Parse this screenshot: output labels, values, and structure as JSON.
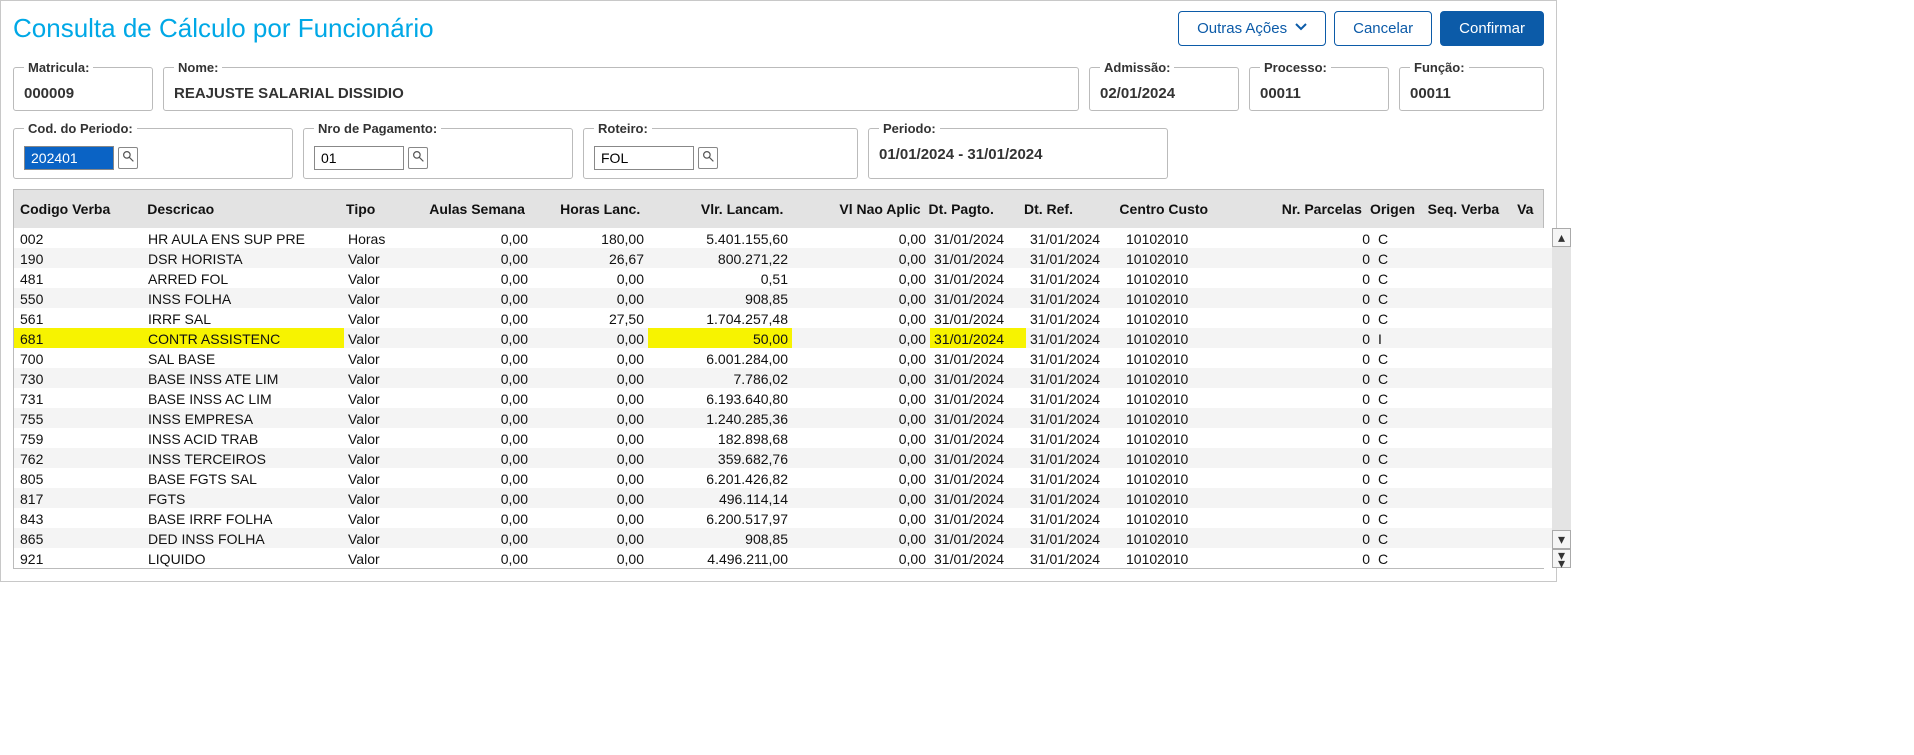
{
  "title": "Consulta de Cálculo por Funcionário",
  "buttons": {
    "outras": "Outras Ações",
    "cancel": "Cancelar",
    "confirm": "Confirmar"
  },
  "labels": {
    "matricula": "Matricula:",
    "nome": "Nome:",
    "admissao": "Admissão:",
    "processo": "Processo:",
    "funcao": "Função:",
    "cod_periodo": "Cod. do Periodo:",
    "nro_pagamento": "Nro de Pagamento:",
    "roteiro": "Roteiro:",
    "periodo": "Periodo:"
  },
  "fields": {
    "matricula": "000009",
    "nome": "REAJUSTE SALARIAL DISSIDIO",
    "admissao": "02/01/2024",
    "processo": "00011",
    "funcao": "00011",
    "cod_periodo": "202401",
    "nro_pagamento": "01",
    "roteiro": "FOL",
    "periodo": "01/01/2024 - 31/01/2024"
  },
  "columns": {
    "cod": "Codigo Verba",
    "desc": "Descricao",
    "tipo": "Tipo",
    "aul": "Aulas Semana",
    "hrs": "Horas Lanc.",
    "vlr": "Vlr. Lancam.",
    "vna": "Vl Nao Aplic",
    "dtp": "Dt. Pagto.",
    "dtr": "Dt. Ref.",
    "cc": "Centro Custo",
    "np": "Nr. Parcelas",
    "ori": "Origen",
    "seq": "Seq. Verba",
    "last": "Va"
  },
  "rows": [
    {
      "cod": "002",
      "desc": "HR AULA ENS SUP PRE",
      "tipo": "Horas",
      "aul": "0,00",
      "hrs": "180,00",
      "vlr": "5.401.155,60",
      "vna": "0,00",
      "dtp": "31/01/2024",
      "dtr": "31/01/2024",
      "cc": "10102010",
      "np": "0",
      "ori": "C",
      "seq": ""
    },
    {
      "cod": "190",
      "desc": "DSR HORISTA",
      "tipo": "Valor",
      "aul": "0,00",
      "hrs": "26,67",
      "vlr": "800.271,22",
      "vna": "0,00",
      "dtp": "31/01/2024",
      "dtr": "31/01/2024",
      "cc": "10102010",
      "np": "0",
      "ori": "C",
      "seq": ""
    },
    {
      "cod": "481",
      "desc": "ARRED FOL",
      "tipo": "Valor",
      "aul": "0,00",
      "hrs": "0,00",
      "vlr": "0,51",
      "vna": "0,00",
      "dtp": "31/01/2024",
      "dtr": "31/01/2024",
      "cc": "10102010",
      "np": "0",
      "ori": "C",
      "seq": ""
    },
    {
      "cod": "550",
      "desc": "INSS FOLHA",
      "tipo": "Valor",
      "aul": "0,00",
      "hrs": "0,00",
      "vlr": "908,85",
      "vna": "0,00",
      "dtp": "31/01/2024",
      "dtr": "31/01/2024",
      "cc": "10102010",
      "np": "0",
      "ori": "C",
      "seq": ""
    },
    {
      "cod": "561",
      "desc": "IRRF SAL",
      "tipo": "Valor",
      "aul": "0,00",
      "hrs": "27,50",
      "vlr": "1.704.257,48",
      "vna": "0,00",
      "dtp": "31/01/2024",
      "dtr": "31/01/2024",
      "cc": "10102010",
      "np": "0",
      "ori": "C",
      "seq": ""
    },
    {
      "cod": "681",
      "desc": "CONTR ASSISTENC",
      "tipo": "Valor",
      "aul": "0,00",
      "hrs": "0,00",
      "vlr": "50,00",
      "vna": "0,00",
      "dtp": "31/01/2024",
      "dtr": "31/01/2024",
      "cc": "10102010",
      "np": "0",
      "ori": "I",
      "seq": "",
      "hl": true
    },
    {
      "cod": "700",
      "desc": "SAL BASE",
      "tipo": "Valor",
      "aul": "0,00",
      "hrs": "0,00",
      "vlr": "6.001.284,00",
      "vna": "0,00",
      "dtp": "31/01/2024",
      "dtr": "31/01/2024",
      "cc": "10102010",
      "np": "0",
      "ori": "C",
      "seq": ""
    },
    {
      "cod": "730",
      "desc": "BASE INSS ATE LIM",
      "tipo": "Valor",
      "aul": "0,00",
      "hrs": "0,00",
      "vlr": "7.786,02",
      "vna": "0,00",
      "dtp": "31/01/2024",
      "dtr": "31/01/2024",
      "cc": "10102010",
      "np": "0",
      "ori": "C",
      "seq": ""
    },
    {
      "cod": "731",
      "desc": "BASE INSS AC LIM",
      "tipo": "Valor",
      "aul": "0,00",
      "hrs": "0,00",
      "vlr": "6.193.640,80",
      "vna": "0,00",
      "dtp": "31/01/2024",
      "dtr": "31/01/2024",
      "cc": "10102010",
      "np": "0",
      "ori": "C",
      "seq": ""
    },
    {
      "cod": "755",
      "desc": "INSS EMPRESA",
      "tipo": "Valor",
      "aul": "0,00",
      "hrs": "0,00",
      "vlr": "1.240.285,36",
      "vna": "0,00",
      "dtp": "31/01/2024",
      "dtr": "31/01/2024",
      "cc": "10102010",
      "np": "0",
      "ori": "C",
      "seq": ""
    },
    {
      "cod": "759",
      "desc": "INSS ACID TRAB",
      "tipo": "Valor",
      "aul": "0,00",
      "hrs": "0,00",
      "vlr": "182.898,68",
      "vna": "0,00",
      "dtp": "31/01/2024",
      "dtr": "31/01/2024",
      "cc": "10102010",
      "np": "0",
      "ori": "C",
      "seq": ""
    },
    {
      "cod": "762",
      "desc": "INSS TERCEIROS",
      "tipo": "Valor",
      "aul": "0,00",
      "hrs": "0,00",
      "vlr": "359.682,76",
      "vna": "0,00",
      "dtp": "31/01/2024",
      "dtr": "31/01/2024",
      "cc": "10102010",
      "np": "0",
      "ori": "C",
      "seq": ""
    },
    {
      "cod": "805",
      "desc": "BASE FGTS SAL",
      "tipo": "Valor",
      "aul": "0,00",
      "hrs": "0,00",
      "vlr": "6.201.426,82",
      "vna": "0,00",
      "dtp": "31/01/2024",
      "dtr": "31/01/2024",
      "cc": "10102010",
      "np": "0",
      "ori": "C",
      "seq": ""
    },
    {
      "cod": "817",
      "desc": "FGTS",
      "tipo": "Valor",
      "aul": "0,00",
      "hrs": "0,00",
      "vlr": "496.114,14",
      "vna": "0,00",
      "dtp": "31/01/2024",
      "dtr": "31/01/2024",
      "cc": "10102010",
      "np": "0",
      "ori": "C",
      "seq": ""
    },
    {
      "cod": "843",
      "desc": "BASE IRRF FOLHA",
      "tipo": "Valor",
      "aul": "0,00",
      "hrs": "0,00",
      "vlr": "6.200.517,97",
      "vna": "0,00",
      "dtp": "31/01/2024",
      "dtr": "31/01/2024",
      "cc": "10102010",
      "np": "0",
      "ori": "C",
      "seq": ""
    },
    {
      "cod": "865",
      "desc": "DED INSS FOLHA",
      "tipo": "Valor",
      "aul": "0,00",
      "hrs": "0,00",
      "vlr": "908,85",
      "vna": "0,00",
      "dtp": "31/01/2024",
      "dtr": "31/01/2024",
      "cc": "10102010",
      "np": "0",
      "ori": "C",
      "seq": ""
    },
    {
      "cod": "921",
      "desc": "LIQUIDO",
      "tipo": "Valor",
      "aul": "0,00",
      "hrs": "0,00",
      "vlr": "4.496.211,00",
      "vna": "0,00",
      "dtp": "31/01/2024",
      "dtr": "31/01/2024",
      "cc": "10102010",
      "np": "0",
      "ori": "C",
      "seq": ""
    }
  ]
}
